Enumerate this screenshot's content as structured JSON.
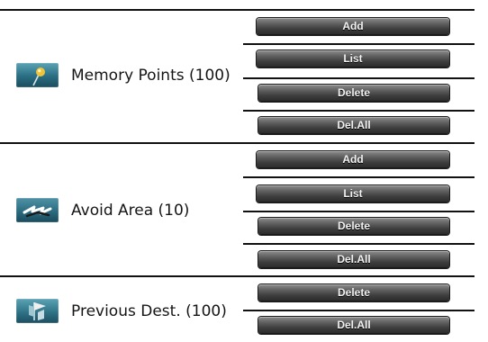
{
  "sections": [
    {
      "label": "Memory Points (100)",
      "icon": "pushpin-icon",
      "buttons": {
        "add": "Add",
        "list": "List",
        "delete": "Delete",
        "del_all": "Del.All"
      }
    },
    {
      "label": "Avoid Area (10)",
      "icon": "avoid-route-icon",
      "buttons": {
        "add": "Add",
        "list": "List",
        "delete": "Delete",
        "del_all": "Del.All"
      }
    },
    {
      "label": "Previous Dest. (100)",
      "icon": "flag-icon",
      "buttons": {
        "delete": "Delete",
        "del_all": "Del.All"
      }
    }
  ],
  "colors": {
    "icon_bg": "#2a6d82",
    "button_bg": "#4a4a4a",
    "button_text": "#f2f2f2",
    "divider": "#111111"
  }
}
